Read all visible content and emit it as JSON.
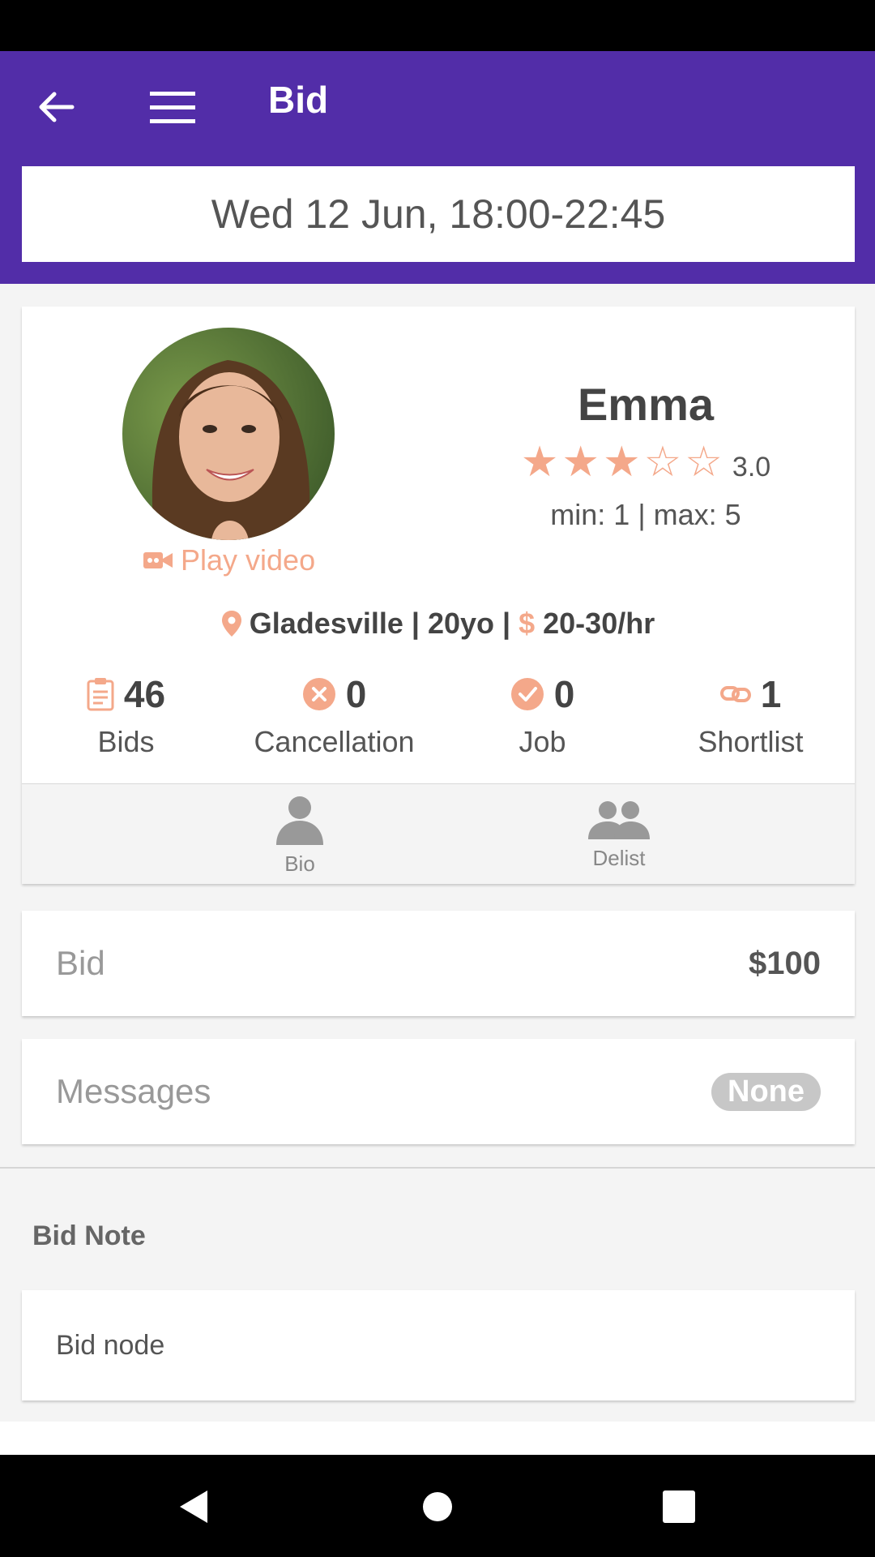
{
  "header": {
    "title": "Bid",
    "date_time": "Wed 12 Jun, 18:00-22:45",
    "color": "#522da8"
  },
  "profile": {
    "name": "Emma",
    "rating": 3,
    "rating_max": 5,
    "rating_text": "3.0",
    "min_max": "min: 1 | max: 5",
    "play_video_label": "Play video",
    "location": "Gladesville",
    "age": "20yo",
    "rate": "20-30/hr",
    "separator": "|",
    "accent_color": "#f4a88a"
  },
  "stats": [
    {
      "icon": "clipboard-icon",
      "value": "46",
      "label": "Bids"
    },
    {
      "icon": "cancel-circle-icon",
      "value": "0",
      "label": "Cancellation"
    },
    {
      "icon": "check-circle-icon",
      "value": "0",
      "label": "Job"
    },
    {
      "icon": "link-icon",
      "value": "1",
      "label": "Shortlist"
    }
  ],
  "tabs": [
    {
      "icon": "person-icon",
      "label": "Bio"
    },
    {
      "icon": "people-icon",
      "label": "Delist"
    }
  ],
  "bid_row": {
    "label": "Bid",
    "value": "$100"
  },
  "messages_row": {
    "label": "Messages",
    "badge": "None"
  },
  "bid_note": {
    "title": "Bid Note",
    "text": "Bid node"
  }
}
